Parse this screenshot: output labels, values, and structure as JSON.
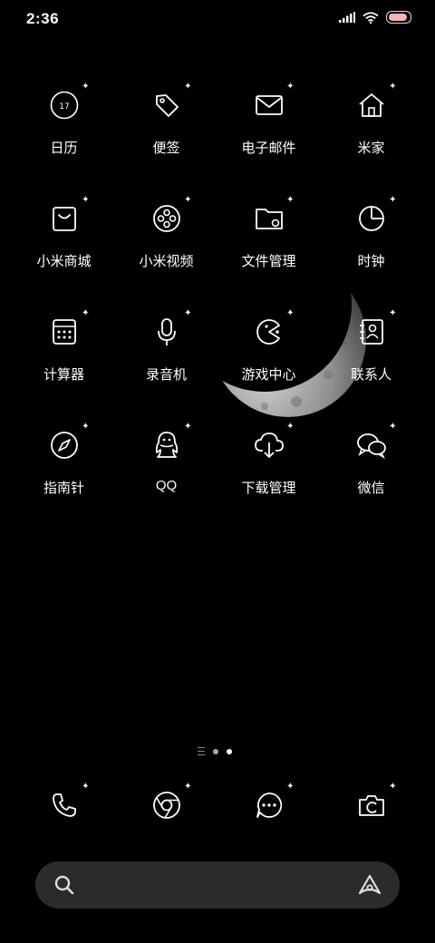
{
  "status_bar": {
    "time": "2:36",
    "icons": [
      "signal-icon",
      "wifi-icon",
      "battery-icon"
    ]
  },
  "home_apps": [
    {
      "label": "日历",
      "icon": "calendar-icon",
      "date": "17"
    },
    {
      "label": "便签",
      "icon": "tag-icon"
    },
    {
      "label": "电子邮件",
      "icon": "mail-icon"
    },
    {
      "label": "米家",
      "icon": "home-icon"
    },
    {
      "label": "小米商城",
      "icon": "shop-icon"
    },
    {
      "label": "小米视频",
      "icon": "film-reel-icon"
    },
    {
      "label": "文件管理",
      "icon": "folder-icon"
    },
    {
      "label": "时钟",
      "icon": "clock-icon"
    },
    {
      "label": "计算器",
      "icon": "calculator-icon"
    },
    {
      "label": "录音机",
      "icon": "microphone-icon"
    },
    {
      "label": "游戏中心",
      "icon": "pacman-icon"
    },
    {
      "label": "联系人",
      "icon": "contacts-icon"
    },
    {
      "label": "指南针",
      "icon": "compass-icon"
    },
    {
      "label": "QQ",
      "icon": "qq-icon"
    },
    {
      "label": "下载管理",
      "icon": "cloud-download-icon"
    },
    {
      "label": "微信",
      "icon": "wechat-icon"
    }
  ],
  "page_indicator": {
    "pages": 2,
    "active": 2
  },
  "dock": [
    {
      "icon": "phone-icon"
    },
    {
      "icon": "browser-icon"
    },
    {
      "icon": "messages-icon"
    },
    {
      "icon": "camera-icon"
    }
  ],
  "search_bar": {
    "left_icon": "search-icon",
    "right_icon": "assistant-icon"
  },
  "colors": {
    "background": "#000000",
    "search_bar": "#2b2b2d",
    "battery_fill": "#f6b3b3"
  }
}
